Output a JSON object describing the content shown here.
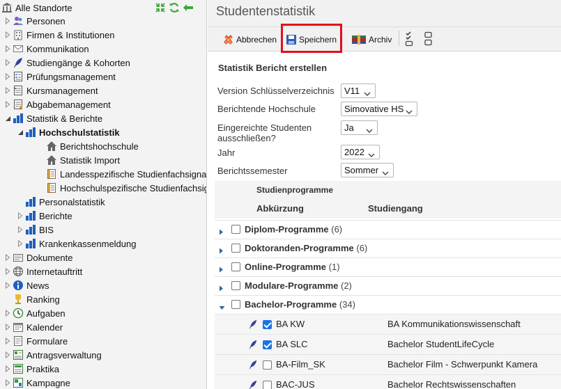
{
  "tree": {
    "root_label": "Alle Standorte",
    "items": [
      {
        "label": "Personen",
        "icon": "people-icon",
        "level": 0,
        "expander": "closed"
      },
      {
        "label": "Firmen & Institutionen",
        "icon": "building-icon",
        "level": 0,
        "expander": "closed"
      },
      {
        "label": "Kommunikation",
        "icon": "envelope-icon",
        "level": 0,
        "expander": "closed"
      },
      {
        "label": "Studiengänge & Kohorten",
        "icon": "feather-icon",
        "level": 0,
        "expander": "closed"
      },
      {
        "label": "Prüfungsmanagement",
        "icon": "exam-list-icon",
        "level": 0,
        "expander": "closed"
      },
      {
        "label": "Kursmanagement",
        "icon": "course-list-icon",
        "level": 0,
        "expander": "closed"
      },
      {
        "label": "Abgabemanagement",
        "icon": "submission-icon",
        "level": 0,
        "expander": "closed"
      },
      {
        "label": "Statistik & Berichte",
        "icon": "bar-chart-icon",
        "level": 0,
        "expander": "open"
      },
      {
        "label": "Hochschulstatistik",
        "icon": "bar-chart-icon",
        "level": 1,
        "expander": "open",
        "bold": true
      },
      {
        "label": "Berichtshochschule",
        "icon": "home-icon",
        "level": 2,
        "expander": "none"
      },
      {
        "label": "Statistik Import",
        "icon": "home-icon",
        "level": 2,
        "expander": "none"
      },
      {
        "label": "Landesspezifische Studienfachsignatu",
        "icon": "key-list-icon",
        "level": 2,
        "expander": "none"
      },
      {
        "label": "Hochschulspezifische Studienfachsign",
        "icon": "key-list-icon",
        "level": 2,
        "expander": "none"
      },
      {
        "label": "Personalstatistik",
        "icon": "bar-chart-icon",
        "level": 1,
        "expander": "none"
      },
      {
        "label": "Berichte",
        "icon": "bar-chart-icon",
        "level": 1,
        "expander": "closed"
      },
      {
        "label": "BIS",
        "icon": "bar-chart-icon",
        "level": 1,
        "expander": "closed"
      },
      {
        "label": "Krankenkassenmeldung",
        "icon": "bar-chart-icon",
        "level": 1,
        "expander": "closed"
      },
      {
        "label": "Dokumente",
        "icon": "documents-icon",
        "level": 0,
        "expander": "closed"
      },
      {
        "label": "Internetauftritt",
        "icon": "globe-icon",
        "level": 0,
        "expander": "closed"
      },
      {
        "label": "News",
        "icon": "info-icon",
        "level": 0,
        "expander": "closed"
      },
      {
        "label": "Ranking",
        "icon": "trophy-icon",
        "level": 0,
        "expander": "none"
      },
      {
        "label": "Aufgaben",
        "icon": "tasks-icon",
        "level": 0,
        "expander": "closed"
      },
      {
        "label": "Kalender",
        "icon": "calendar-icon",
        "level": 0,
        "expander": "closed"
      },
      {
        "label": "Formulare",
        "icon": "form-icon",
        "level": 0,
        "expander": "closed"
      },
      {
        "label": "Antragsverwaltung",
        "icon": "application-icon",
        "level": 0,
        "expander": "closed"
      },
      {
        "label": "Praktika",
        "icon": "internship-icon",
        "level": 0,
        "expander": "closed"
      },
      {
        "label": "Kampagne",
        "icon": "campaign-icon",
        "level": 0,
        "expander": "closed"
      }
    ]
  },
  "main": {
    "title": "Studentenstatistik",
    "toolbar": {
      "cancel_label": "Abbrechen",
      "save_label": "Speichern",
      "archive_label": "Archiv"
    },
    "section_title": "Statistik Bericht erstellen",
    "form": [
      {
        "label": "Version Schlüsselverzeichnis",
        "value": "V11"
      },
      {
        "label": "Berichtende Hochschule",
        "value": "Simovative HS"
      },
      {
        "label": "Eingereichte Studenten ausschließen?",
        "value": "Ja"
      },
      {
        "label": "Jahr",
        "value": "2022"
      },
      {
        "label": "Berichtssemester",
        "value": "Sommer"
      }
    ],
    "grid": {
      "group_header": "Studienprogramme",
      "col_abbr": "Abkürzung",
      "col_course": "Studiengang",
      "groups": [
        {
          "label": "Diplom-Programme",
          "count": "(6)",
          "expanded": false
        },
        {
          "label": "Doktoranden-Programme",
          "count": "(6)",
          "expanded": false
        },
        {
          "label": "Online-Programme",
          "count": "(1)",
          "expanded": false
        },
        {
          "label": "Modulare-Programme",
          "count": "(2)",
          "expanded": false
        },
        {
          "label": "Bachelor-Programme",
          "count": "(34)",
          "expanded": true
        }
      ],
      "items": [
        {
          "abbr": "BA KW",
          "course": "BA Kommunikationswissenschaft",
          "checked": true
        },
        {
          "abbr": "BA SLC",
          "course": "Bachelor StudentLifeCycle",
          "checked": true
        },
        {
          "abbr": "BA-Film_SK",
          "course": "Bachelor Film - Schwerpunkt Kamera",
          "checked": false
        },
        {
          "abbr": "BAC-JUS",
          "course": "Bachelor Rechtswissenschaften",
          "checked": false
        }
      ]
    }
  },
  "colors": {
    "accent": "#1a73e8",
    "highlight": "#e0101a",
    "chart_blue": "#1f5fbf"
  }
}
